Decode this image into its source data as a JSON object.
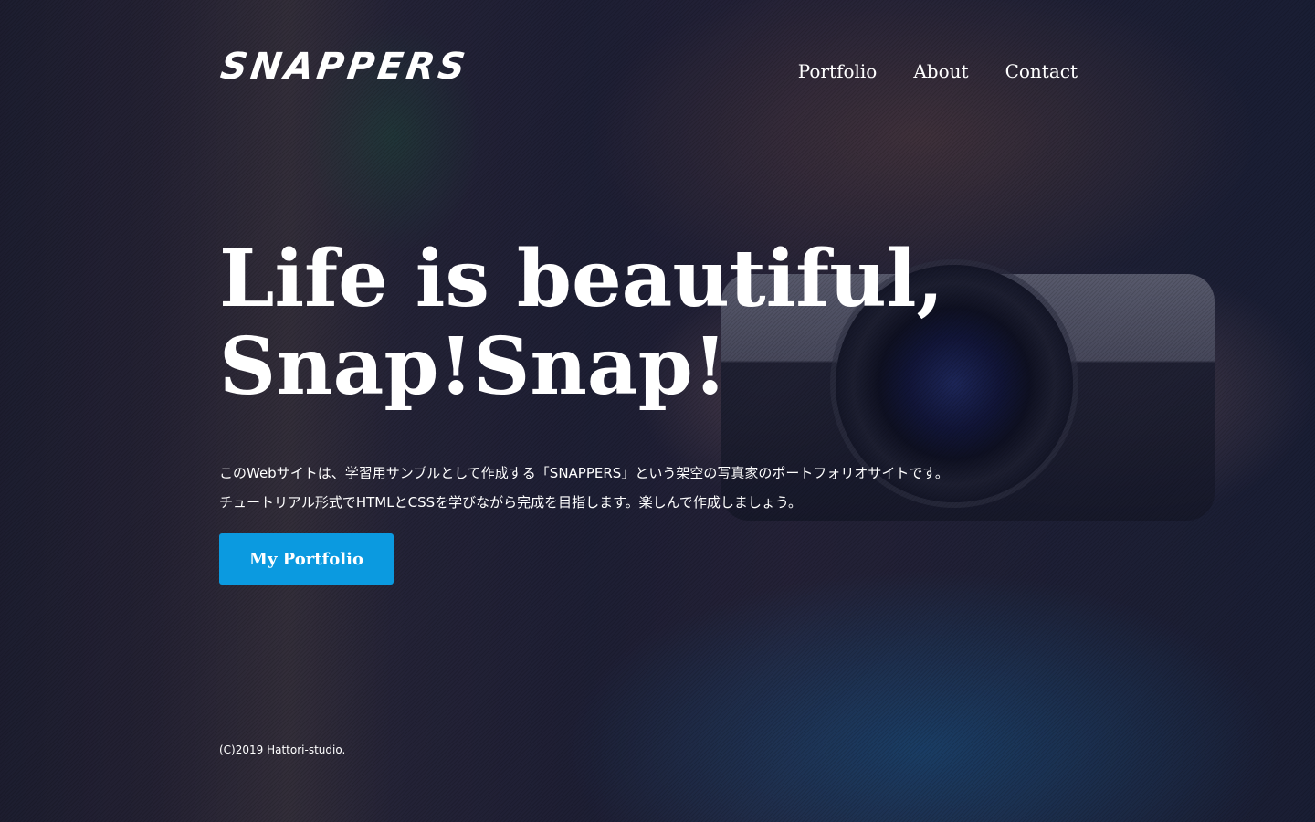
{
  "header": {
    "logo": "SNAPPERS",
    "nav": [
      {
        "label": "Portfolio"
      },
      {
        "label": "About"
      },
      {
        "label": "Contact"
      }
    ]
  },
  "hero": {
    "headline_line1": "Life is beautiful,",
    "headline_line2": "Snap!Snap!",
    "description_line1": "このWebサイトは、学習用サンプルとして作成する「SNAPPERS」という架空の写真家のポートフォリオサイトです。",
    "description_line2": "チュートリアル形式でHTMLとCSSを学びながら完成を目指します。楽しんで作成しましょう。",
    "cta_label": "My Portfolio"
  },
  "footer": {
    "copyright": "(C)2019 Hattori-studio."
  },
  "colors": {
    "accent": "#0b9ae0",
    "overlay": "#121630",
    "text": "#ffffff"
  }
}
